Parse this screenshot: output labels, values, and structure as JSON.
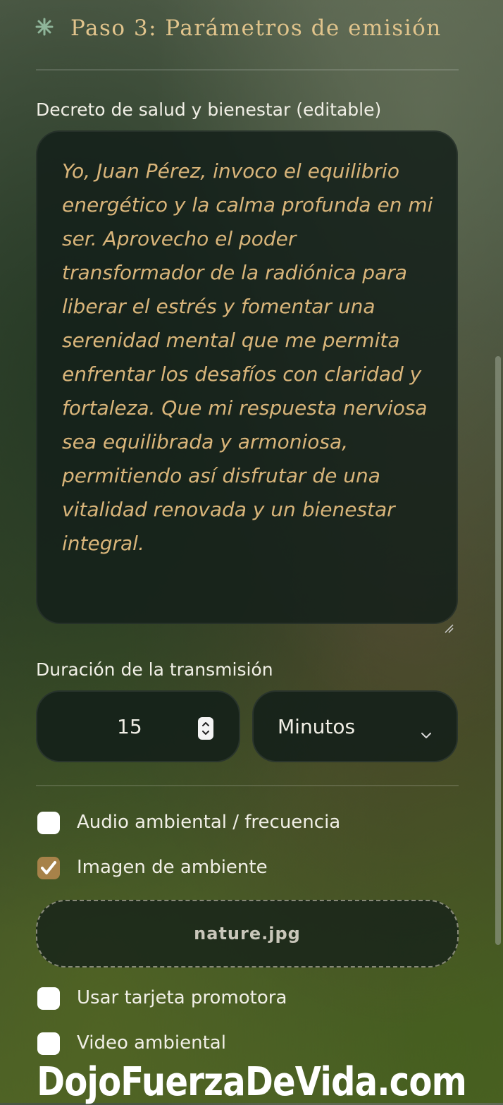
{
  "step": {
    "icon": "snowflake-asterisk-icon",
    "title": "Paso 3: Parámetros de emisión"
  },
  "decree": {
    "label": "Decreto de salud y bienestar (editable)",
    "text": "Yo, Juan Pérez, invoco el equilibrio energético y la calma profunda en mi ser. Aprovecho el poder transformador de la radiónica para liberar el estrés y fomentar una serenidad mental que me permita enfrentar los desafíos con claridad y fortaleza. Que mi respuesta nerviosa sea equilibrada y armoniosa, permitiendo así disfrutar de una vitalidad renovada y un bienestar integral."
  },
  "duration": {
    "label": "Duración de la transmisión",
    "value": "15",
    "unit": "Minutos"
  },
  "options": {
    "audio": {
      "label": "Audio ambiental / frecuencia",
      "checked": false
    },
    "image": {
      "label": "Imagen de ambiente",
      "checked": true
    },
    "image_file": "nature.jpg",
    "promo_card": {
      "label": "Usar tarjeta promotora",
      "checked": false
    },
    "video": {
      "label": "Video ambiental",
      "checked": false
    }
  },
  "watermark": "DojoFuerzaDeVida.com",
  "colors": {
    "accent_gold": "#e1c48c",
    "decree_text": "#d9b57a",
    "checkbox_checked": "#a78249",
    "icon_green": "#8fb59a"
  }
}
